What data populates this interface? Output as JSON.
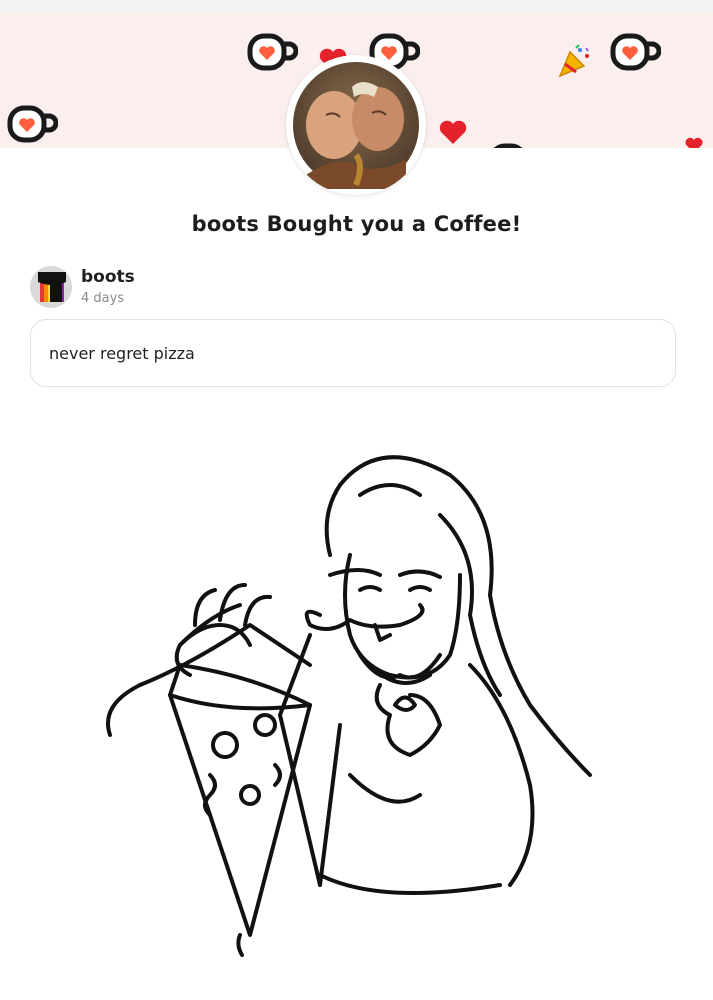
{
  "banner": {
    "background": "#fbefed",
    "decorations": [
      "coffee-cup-icon",
      "heart-icon",
      "party-popper-icon"
    ]
  },
  "creator_avatar": {
    "description": "profile-photo"
  },
  "title": "boots Bought you a Coffee!",
  "supporter": {
    "name": "boots",
    "time_ago": "4 days"
  },
  "message": {
    "text": "never regret pizza"
  },
  "attachment": {
    "kind": "sketch-illustration"
  },
  "colors": {
    "accent": "#ff5f3c",
    "cup_outline": "#1a1a1a",
    "heart": "#e5212b"
  }
}
